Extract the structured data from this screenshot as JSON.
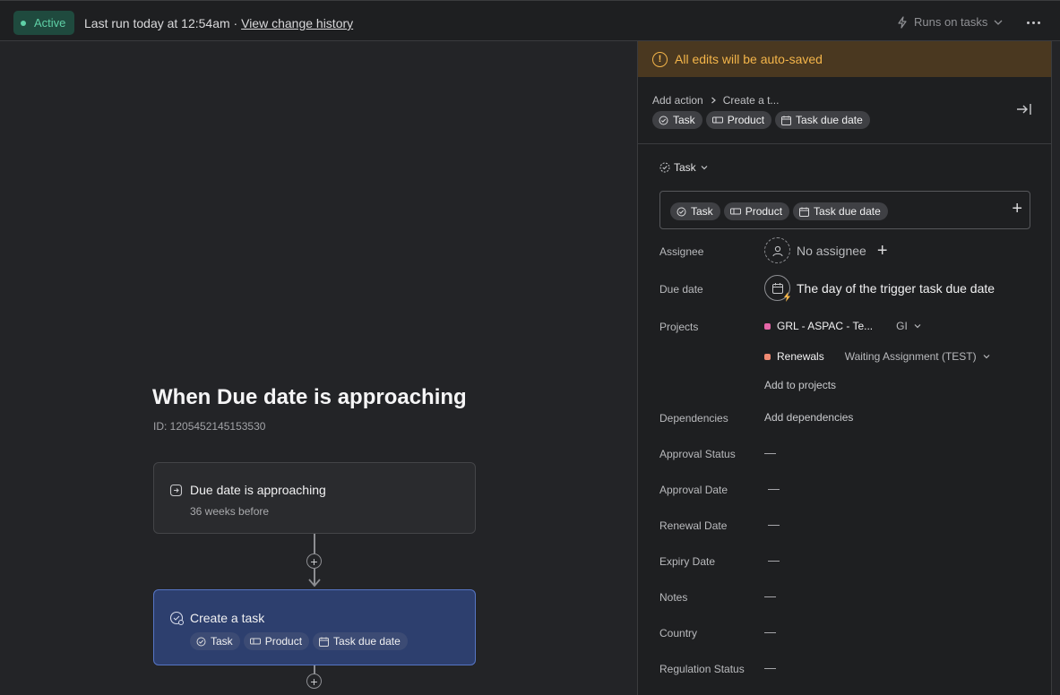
{
  "topbar": {
    "status": "Active",
    "last_run": "Last run today at 12:54am · ",
    "history_link": "View change history",
    "runs_on": "Runs on tasks"
  },
  "canvas": {
    "rule_title": "When Due date is approaching",
    "rule_id": "ID: 1205452145153530",
    "trigger": {
      "title": "Due date is approaching",
      "subtitle": "36 weeks before"
    },
    "action": {
      "title": "Create a task",
      "chips": [
        "Task",
        "Product",
        "Task due date"
      ]
    }
  },
  "panel": {
    "banner": "All edits will be auto-saved",
    "breadcrumb": [
      "Add action",
      "Create a t..."
    ],
    "chips": [
      "Task",
      "Product",
      "Task due date"
    ],
    "type_select": "Task",
    "name_chips": [
      "Task",
      "Product",
      "Task due date"
    ],
    "fields": {
      "assignee_label": "Assignee",
      "assignee_value": "No assignee",
      "due_date_label": "Due date",
      "due_date_value": "The day of the trigger task due date",
      "projects_label": "Projects",
      "projects": [
        {
          "name": "GRL - ASPAC - Te...",
          "section": "GI",
          "color": "#e566a8"
        },
        {
          "name": "Renewals",
          "section": "Waiting Assignment (TEST)",
          "color": "#f08a73"
        }
      ],
      "add_projects": "Add to projects",
      "dependencies_label": "Dependencies",
      "dependencies_value": "Add dependencies",
      "approval_status_label": "Approval Status",
      "approval_date_label": "Approval Date",
      "renewal_date_label": "Renewal Date",
      "expiry_date_label": "Expiry Date",
      "notes_label": "Notes",
      "country_label": "Country",
      "regulation_status_label": "Regulation Status",
      "empty": "—"
    }
  },
  "colors": {
    "accent_blue": "#2d3f6e",
    "banner_bg": "#4a3820",
    "banner_text": "#f4b54a",
    "active_green": "#5fd0a6"
  }
}
